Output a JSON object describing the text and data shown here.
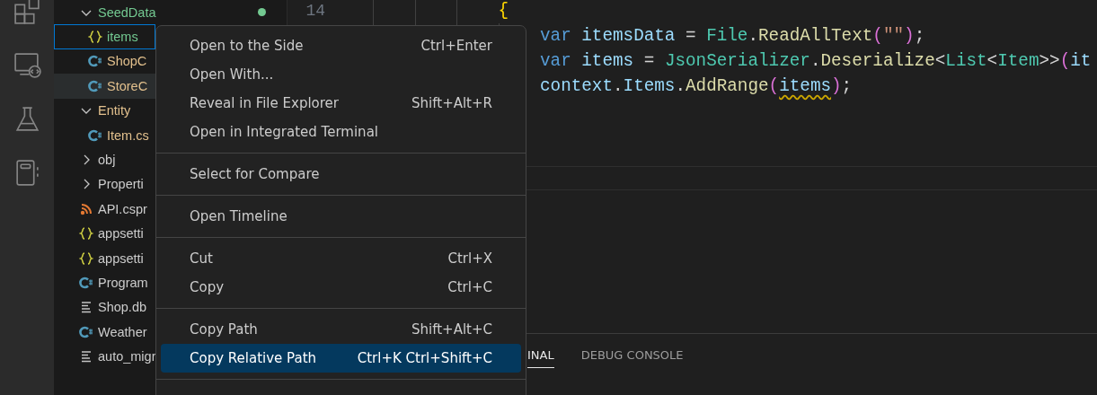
{
  "activity_bar": [
    {
      "kind": "extensions"
    },
    {
      "kind": "remote"
    },
    {
      "kind": "testing"
    },
    {
      "kind": "notebook"
    }
  ],
  "explorer": {
    "tree": [
      {
        "name": "SeedData",
        "kind": "folder",
        "expanded": true,
        "color": "#73c991",
        "status_dot": true,
        "selected": false,
        "hovered": false,
        "children": [
          {
            "name": "items",
            "kind": "json",
            "color": "#73c991",
            "selected": true,
            "hovered": false
          },
          {
            "name": "ShopC",
            "kind": "csharp",
            "color": "#e2c08d",
            "selected": false,
            "hovered": false
          },
          {
            "name": "StoreC",
            "kind": "csharp",
            "color": "#e2c08d",
            "selected": false,
            "hovered": true
          }
        ]
      },
      {
        "name": "Entity",
        "kind": "folder",
        "expanded": true,
        "color": "#e2c08d",
        "selected": false,
        "hovered": false,
        "children": [
          {
            "name": "Item.cs",
            "kind": "csharp",
            "color": "#e2c08d",
            "selected": false,
            "hovered": false
          }
        ]
      },
      {
        "name": "obj",
        "kind": "folder",
        "expanded": false,
        "selected": false,
        "hovered": false
      },
      {
        "name": "Properti",
        "kind": "folder",
        "expanded": false,
        "selected": false,
        "hovered": false
      },
      {
        "name": "API.cspr",
        "kind": "project",
        "selected": false,
        "hovered": false
      },
      {
        "name": "appsetti",
        "kind": "json",
        "selected": false,
        "hovered": false
      },
      {
        "name": "appsetti",
        "kind": "json",
        "selected": false,
        "hovered": false
      },
      {
        "name": "Program",
        "kind": "csharp",
        "selected": false,
        "hovered": false
      },
      {
        "name": "Shop.db",
        "kind": "text",
        "selected": false,
        "hovered": false
      },
      {
        "name": "Weather",
        "kind": "csharp",
        "selected": false,
        "hovered": false
      },
      {
        "name": "auto_migr",
        "kind": "text",
        "selected": false,
        "hovered": false
      }
    ]
  },
  "editor": {
    "lines": [
      {
        "number": "14",
        "tokens": [
          {
            "text": "{",
            "kind": "bracket1"
          }
        ],
        "children": [
          {
            "tokens": [
              {
                "text": "var ",
                "kind": "keyword"
              },
              {
                "text": "itemsData",
                "kind": "variable"
              },
              {
                "text": " = ",
                "kind": "punct"
              },
              {
                "text": "File",
                "kind": "type"
              },
              {
                "text": ".",
                "kind": "punct"
              },
              {
                "text": "ReadAllText",
                "kind": "method"
              },
              {
                "text": "(",
                "kind": "bracket2"
              },
              {
                "text": "\"\"",
                "kind": "string"
              },
              {
                "text": ")",
                "kind": "bracket2"
              },
              {
                "text": ";",
                "kind": "punct"
              }
            ]
          },
          {
            "tokens": [
              {
                "text": "var ",
                "kind": "keyword"
              },
              {
                "text": "items",
                "kind": "variable"
              },
              {
                "text": " = ",
                "kind": "punct"
              },
              {
                "text": "JsonSerializer",
                "kind": "type"
              },
              {
                "text": ".",
                "kind": "punct"
              },
              {
                "text": "Deserialize",
                "kind": "method"
              },
              {
                "text": "<",
                "kind": "punct"
              },
              {
                "text": "List",
                "kind": "type"
              },
              {
                "text": "<",
                "kind": "punct"
              },
              {
                "text": "Item",
                "kind": "type"
              },
              {
                "text": ">>",
                "kind": "punct"
              },
              {
                "text": "(",
                "kind": "bracket2"
              },
              {
                "text": "it",
                "kind": "variable"
              }
            ]
          },
          {
            "tokens": [
              {
                "text": "context",
                "kind": "variable"
              },
              {
                "text": ".",
                "kind": "punct"
              },
              {
                "text": "Items",
                "kind": "variable"
              },
              {
                "text": ".",
                "kind": "punct"
              },
              {
                "text": "AddRange",
                "kind": "method"
              },
              {
                "text": "(",
                "kind": "bracket2"
              },
              {
                "text": "items",
                "kind": "variable",
                "warning": true
              },
              {
                "text": ")",
                "kind": "bracket2"
              },
              {
                "text": ";",
                "kind": "punct"
              }
            ]
          }
        ]
      }
    ]
  },
  "panel": {
    "tabs": [
      {
        "label": "INAL",
        "selected": true
      },
      {
        "label": "DEBUG CONSOLE",
        "selected": false
      }
    ]
  },
  "context_menu": {
    "groups": [
      {
        "items": [
          {
            "label": "Open to the Side",
            "shortcut": "Ctrl+Enter",
            "selected": false
          },
          {
            "label": "Open With...",
            "selected": false
          },
          {
            "label": "Reveal in File Explorer",
            "shortcut": "Shift+Alt+R",
            "selected": false
          },
          {
            "label": "Open in Integrated Terminal",
            "selected": false
          }
        ]
      },
      {
        "items": [
          {
            "label": "Select for Compare",
            "selected": false
          }
        ]
      },
      {
        "items": [
          {
            "label": "Open Timeline",
            "selected": false
          }
        ]
      },
      {
        "items": [
          {
            "label": "Cut",
            "shortcut": "Ctrl+X",
            "selected": false
          },
          {
            "label": "Copy",
            "shortcut": "Ctrl+C",
            "selected": false
          }
        ]
      },
      {
        "items": [
          {
            "label": "Copy Path",
            "shortcut": "Shift+Alt+C",
            "selected": false
          },
          {
            "label": "Copy Relative Path",
            "shortcut": "Ctrl+K Ctrl+Shift+C",
            "selected": true
          }
        ]
      }
    ]
  }
}
